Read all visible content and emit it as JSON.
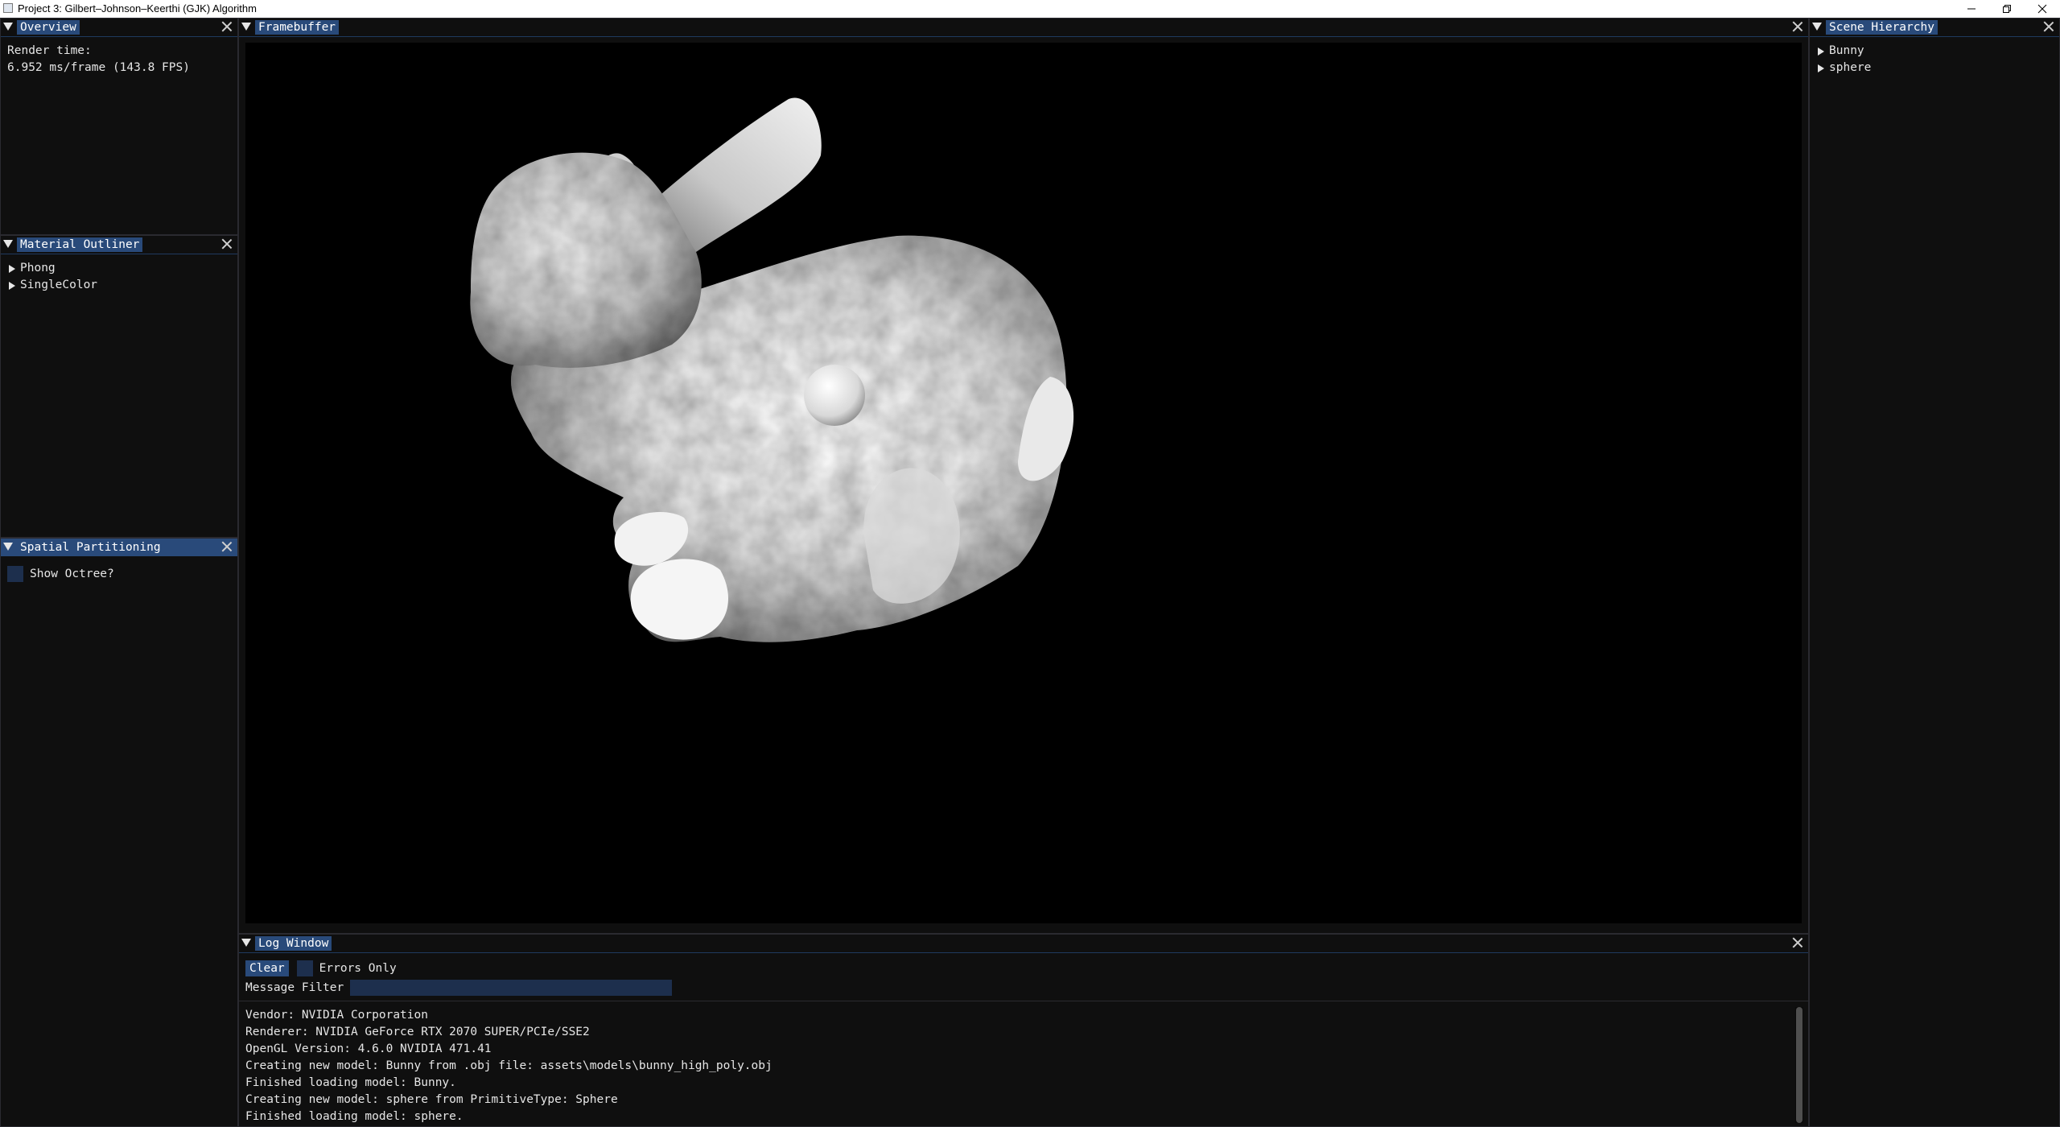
{
  "window": {
    "title": "Project 3: Gilbert–Johnson–Keerthi (GJK) Algorithm"
  },
  "overview": {
    "title": "Overview",
    "render_time_label": "Render time:",
    "render_time_value": "6.952 ms/frame (143.8 FPS)"
  },
  "material_outliner": {
    "title": "Material Outliner",
    "items": [
      {
        "label": "Phong"
      },
      {
        "label": "SingleColor"
      }
    ]
  },
  "spatial_partitioning": {
    "title": "Spatial Partitioning",
    "show_octree_label": "Show Octree?",
    "show_octree_checked": false
  },
  "framebuffer": {
    "title": "Framebuffer"
  },
  "scene_hierarchy": {
    "title": "Scene Hierarchy",
    "items": [
      {
        "label": "Bunny"
      },
      {
        "label": "sphere"
      }
    ]
  },
  "log_window": {
    "title": "Log Window",
    "clear_label": "Clear",
    "errors_only_label": "Errors Only",
    "errors_only_checked": false,
    "message_filter_label": "Message Filter",
    "message_filter_value": "",
    "lines": [
      "Vendor: NVIDIA Corporation",
      "Renderer: NVIDIA GeForce RTX 2070 SUPER/PCIe/SSE2",
      "OpenGL Version: 4.6.0 NVIDIA 471.41",
      "Creating new model: Bunny from .obj file: assets\\models\\bunny_high_poly.obj",
      "Finished loading model: Bunny.",
      "Creating new model: sphere from PrimitiveType: Sphere",
      "Finished loading model: sphere."
    ]
  },
  "colors": {
    "panel_bg": "#0f0f0f",
    "tab_active": "#294a7a",
    "widget_bg": "#1d2f4d",
    "viewport_bg": "#000000"
  }
}
